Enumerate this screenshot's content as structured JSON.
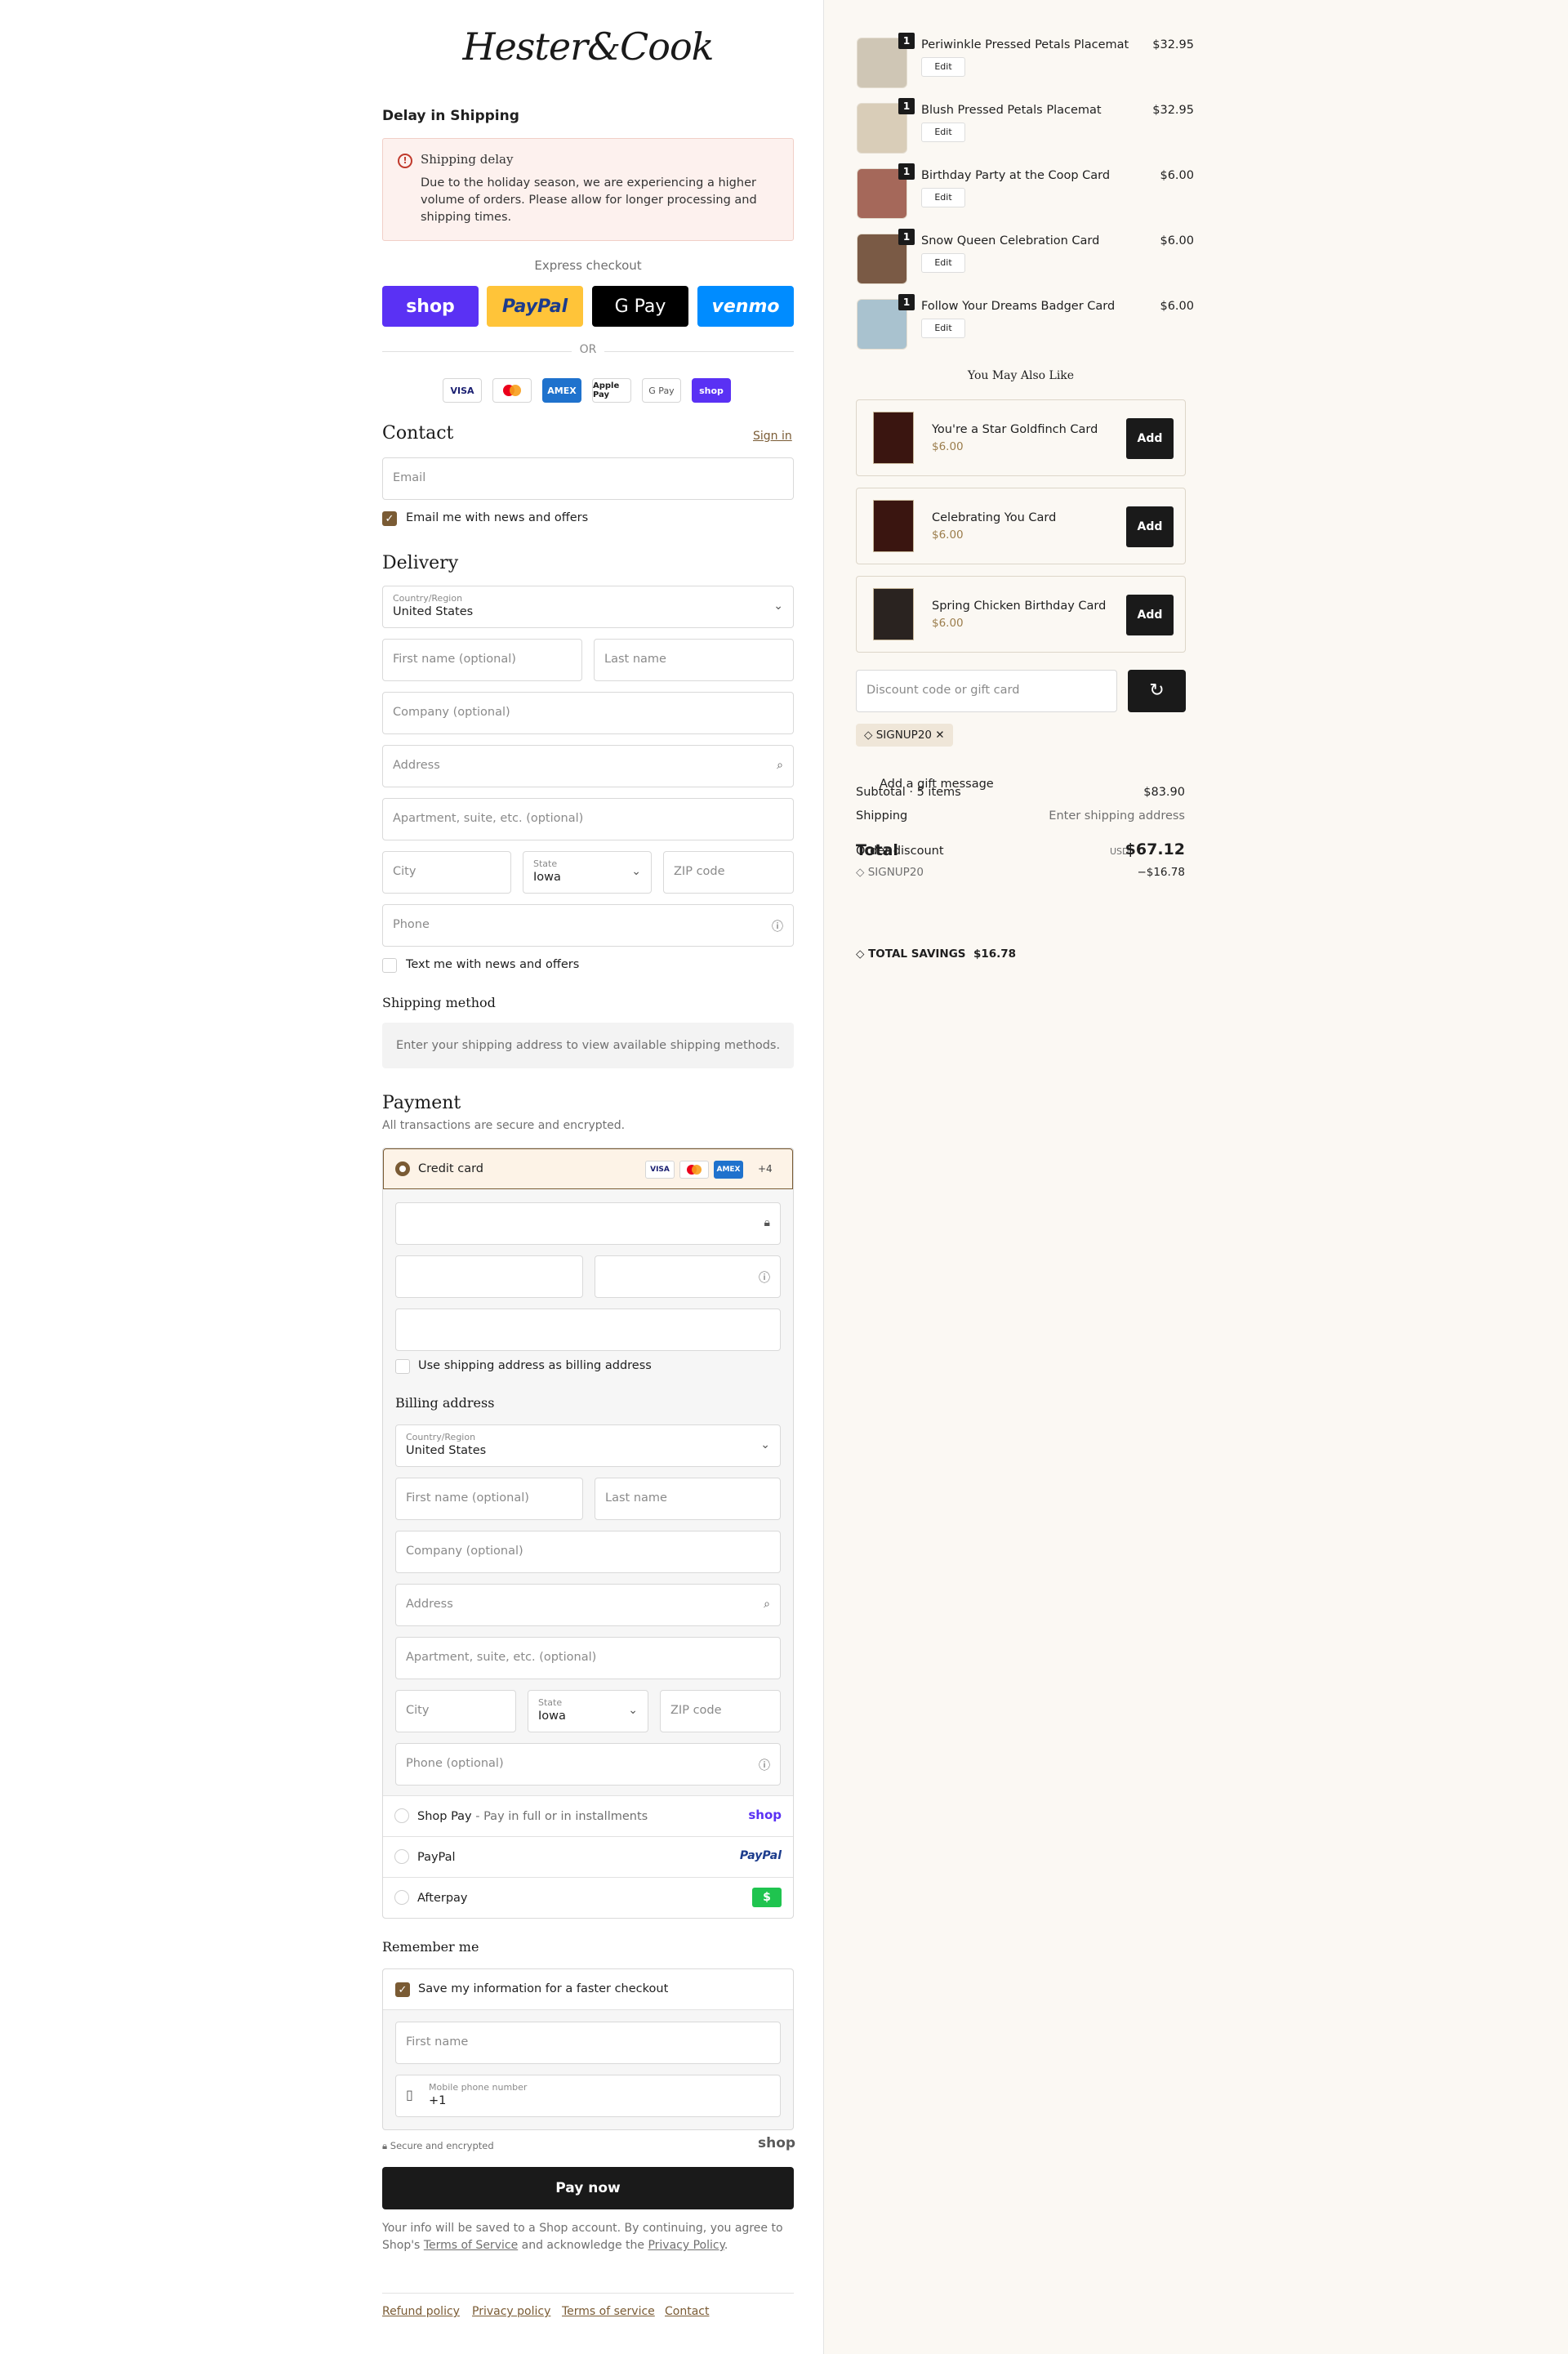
{
  "brand": {
    "logo_text": "Hester&Cook"
  },
  "delay": {
    "heading": "Delay in Shipping",
    "notice_title": "Shipping delay",
    "notice_message": "Due to the holiday season, we are experiencing a higher volume of orders. Please allow for longer processing and shipping times."
  },
  "express": {
    "label": "Express checkout",
    "buttons": [
      "shop",
      "PayPal",
      "G Pay",
      "venmo"
    ],
    "or_label": "OR",
    "card_icons": [
      "VISA",
      "MC",
      "AMEX",
      "Apple Pay",
      "G Pay",
      "shop"
    ]
  },
  "contact": {
    "heading": "Contact",
    "signin_link": "Sign in",
    "email_placeholder": "Email",
    "news_label": "Email me with news and offers"
  },
  "delivery": {
    "heading": "Delivery",
    "country_label": "Country/Region",
    "country_value": "United States",
    "first_name_ph": "First name (optional)",
    "last_name_ph": "Last name",
    "company_ph": "Company (optional)",
    "address_ph": "Address",
    "apartment_ph": "Apartment, suite, etc. (optional)",
    "city_ph": "City",
    "state_label": "State",
    "state_value": "Iowa",
    "zip_ph": "ZIP code",
    "phone_ph": "Phone",
    "text_label": "Text me with news and offers"
  },
  "shipping_method": {
    "heading": "Shipping method",
    "message": "Enter your shipping address to view available shipping methods."
  },
  "payment": {
    "heading": "Payment",
    "subtitle": "All transactions are secure and encrypted.",
    "credit_label": "Credit card",
    "more_cards": "+4",
    "billing_same_label": "Use shipping address as billing address",
    "billing_heading": "Billing address",
    "billing": {
      "country_label": "Country/Region",
      "country_value": "United States",
      "first_name_ph": "First name (optional)",
      "last_name_ph": "Last name",
      "company_ph": "Company (optional)",
      "address_ph": "Address",
      "apartment_ph": "Apartment, suite, etc. (optional)",
      "city_ph": "City",
      "state_label": "State",
      "state_value": "Iowa",
      "zip_ph": "ZIP code",
      "phone_ph": "Phone (optional)"
    },
    "shop_pay_label": "Shop Pay",
    "shop_pay_sub": " - Pay in full or in installments",
    "shop_pay_logo": "shop",
    "paypal_label": "PayPal",
    "paypal_logo": "PayPal",
    "afterpay_label": "Afterpay",
    "afterpay_logo": "$"
  },
  "remember": {
    "heading": "Remember me",
    "save_label": "Save my information for a faster checkout",
    "first_name_ph": "First name",
    "mobile_label": "Mobile phone number",
    "mobile_value": "+1",
    "secure_label": "Secure and encrypted",
    "shop_logo": "shop"
  },
  "pay_now": "Pay now",
  "legal": {
    "text_a": "Your info will be saved to a Shop account. By continuing, you agree to Shop's ",
    "terms": "Terms of Service",
    "text_b": " and acknowledge the ",
    "privacy": "Privacy Policy",
    "text_c": "."
  },
  "footer_links": [
    "Refund policy",
    "Privacy policy",
    "Terms of service",
    "Contact"
  ],
  "cart": {
    "items": [
      {
        "name": "Periwinkle Pressed Petals Placemat",
        "price": "$32.95",
        "qty": "1",
        "edit": "Edit"
      },
      {
        "name": "Blush Pressed Petals Placemat",
        "price": "$32.95",
        "qty": "1",
        "edit": "Edit"
      },
      {
        "name": "Birthday Party at the Coop Card",
        "price": "$6.00",
        "qty": "1",
        "edit": "Edit"
      },
      {
        "name": "Snow Queen Celebration Card",
        "price": "$6.00",
        "qty": "1",
        "edit": "Edit"
      },
      {
        "name": "Follow Your Dreams Badger Card",
        "price": "$6.00",
        "qty": "1",
        "edit": "Edit"
      }
    ],
    "also_like_heading": "You May Also Like",
    "recommendations": [
      {
        "name": "You're a Star Goldfinch Card",
        "price": "$6.00",
        "add": "Add"
      },
      {
        "name": "Celebrating You Card",
        "price": "$6.00",
        "add": "Add"
      },
      {
        "name": "Spring Chicken Birthday Card",
        "price": "$6.00",
        "add": "Add"
      }
    ],
    "discount_ph": "Discount code or gift card",
    "applied_code": "SIGNUP20",
    "gift_message": "Add a gift message",
    "subtotal_label": "Subtotal · 5 items",
    "subtotal_value": "$83.90",
    "shipping_label": "Shipping",
    "shipping_value": "Enter shipping address",
    "order_discount_label": "Order discount",
    "discount_code": "SIGNUP20",
    "discount_value": "−$16.78",
    "total_label": "Total",
    "currency": "USD",
    "total_value": "$67.12",
    "savings_label": "TOTAL SAVINGS",
    "savings_value": "$16.78"
  },
  "colors": {
    "accent": "#7a5b34",
    "shop": "#5a31f4",
    "paypal_bg": "#ffc439",
    "venmo": "#008cff",
    "right_bg": "#fbf8f3"
  }
}
